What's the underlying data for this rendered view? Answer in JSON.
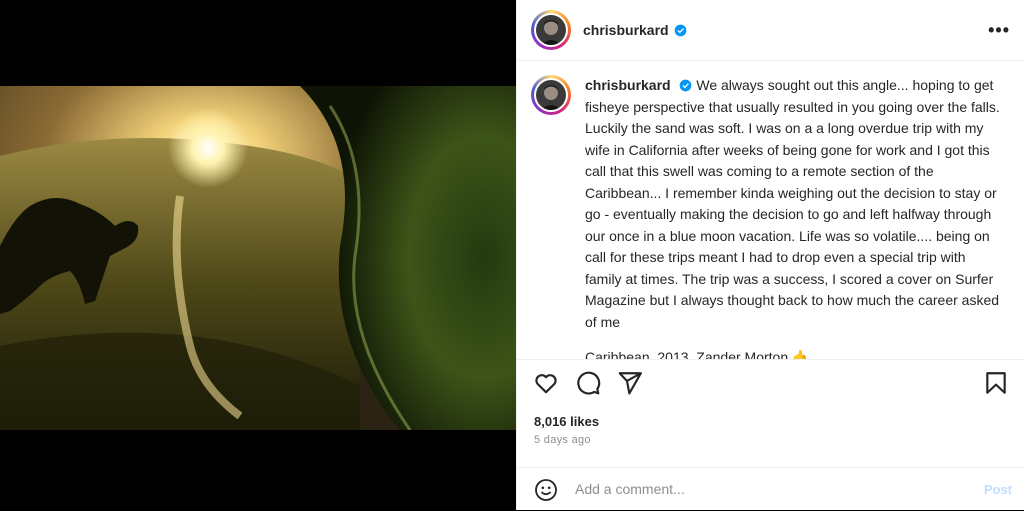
{
  "post": {
    "username": "chrisburkard",
    "verified": true,
    "more_label": "•••",
    "caption": "We always sought out this angle... hoping to get fisheye perspective that usually resulted in you going over the falls. Luckily the sand was soft. I was on a a long overdue trip with my wife in California after weeks of being gone for work and I got this call that this swell was coming to a remote section of the Caribbean... I remember kinda weighing out the decision to stay or go - eventually making the decision to go and left halfway through our once in a blue moon vacation. Life was so volatile.... being on call for these trips meant I had to drop even a special trip with family at times. The trip was a success, I scored a cover on Surfer Magazine but I always thought back to how much the career asked of me",
    "location_line": "Caribbean, 2013. Zander Morton 🤙",
    "caption_age": "5d",
    "likes": "8,016 likes",
    "time_ago": "5 days ago"
  },
  "comment": {
    "placeholder": "Add a comment...",
    "post_label": "Post"
  },
  "icons": {
    "like": "heart-icon",
    "comment": "comment-icon",
    "share": "share-icon",
    "save": "bookmark-icon",
    "emoji": "emoji-icon"
  },
  "colors": {
    "verified": "#0095f6",
    "post_button_disabled": "#c0dffd"
  }
}
